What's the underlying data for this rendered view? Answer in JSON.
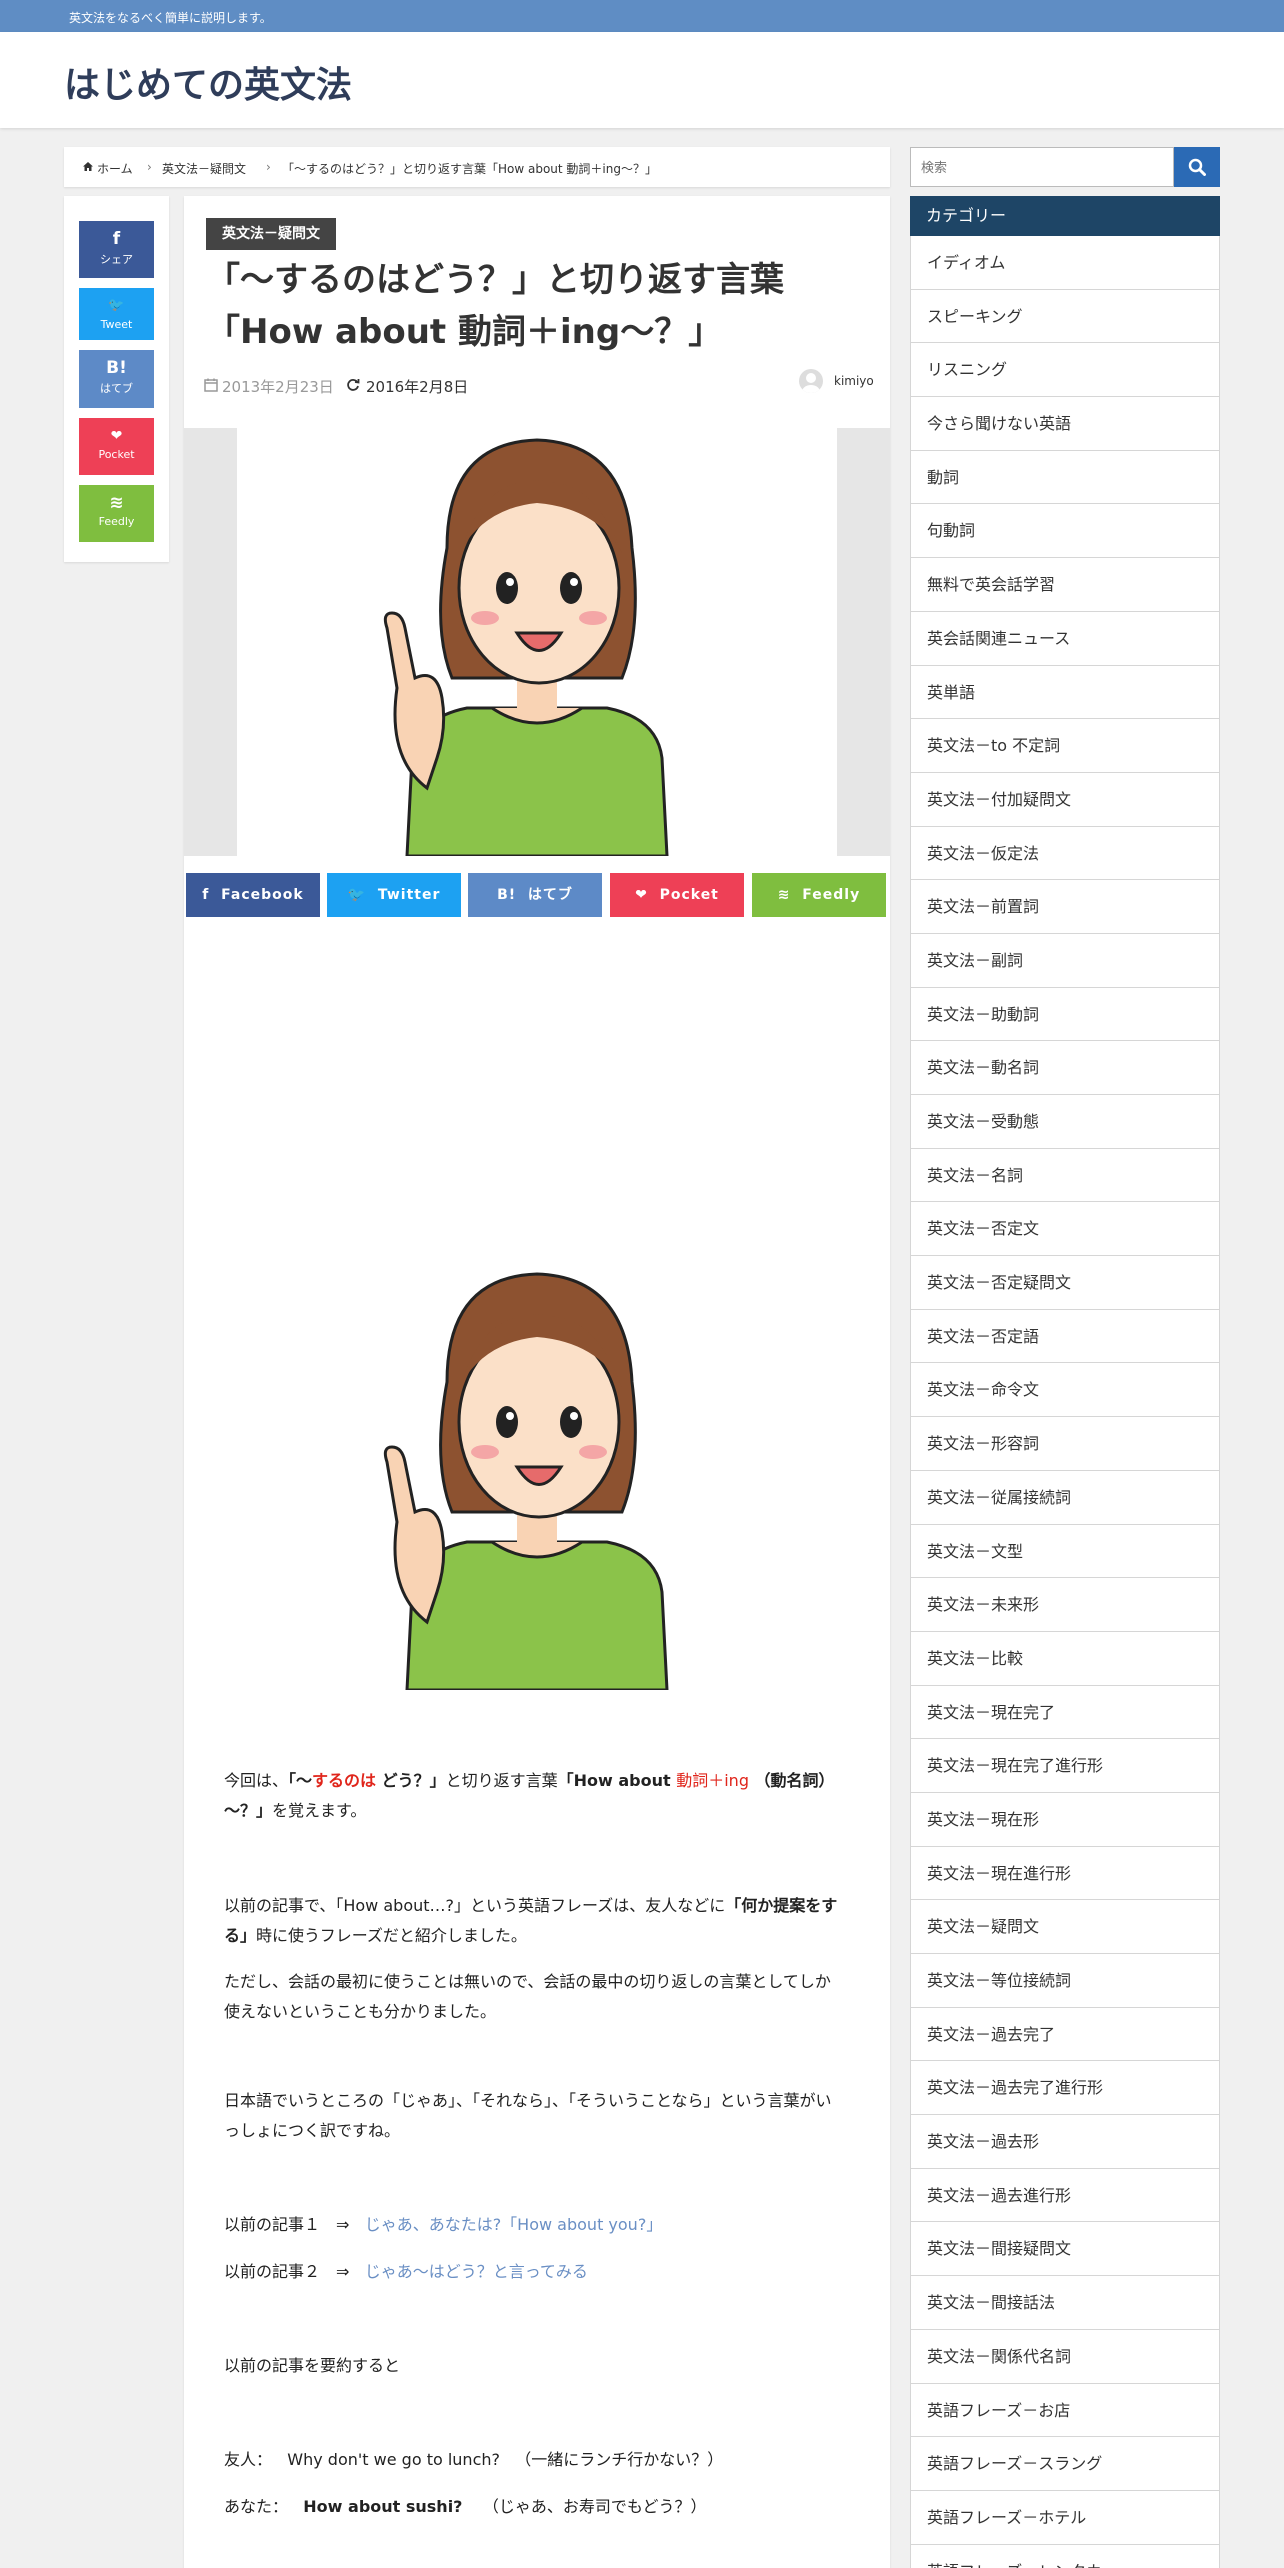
{
  "topbar": {
    "tagline": "英文法をなるべく簡単に説明します。"
  },
  "site": {
    "title": "はじめての英文法"
  },
  "breadcrumb": {
    "home": "ホーム",
    "category": "英文法－疑問文",
    "current": "「～するのはどう？」と切り返す言葉「How about 動詞＋ing～？」",
    "sep": "›"
  },
  "share_vertical": [
    {
      "icon": "f",
      "label": "シェア",
      "color": "#3b5998"
    },
    {
      "icon": "🐦",
      "label": "Tweet",
      "color": "#1da1f2"
    },
    {
      "icon": "B!",
      "label": "はてブ",
      "color": "#5d8ac7"
    },
    {
      "icon": "❤",
      "label": "Pocket",
      "color": "#ee4056"
    },
    {
      "icon": "≋",
      "label": "Feedly",
      "color": "#7fbe3f"
    }
  ],
  "article": {
    "category": "英文法－疑問文",
    "title_line1": "「～するのはどう？」と切り返す言葉",
    "title_line2": "「How about 動詞＋ing～？」",
    "published": "2013年2月23日",
    "updated": "2016年2月8日",
    "author": "kimiyo"
  },
  "share_horizontal": [
    {
      "icon": "f",
      "label": "Facebook",
      "color": "#3b5998"
    },
    {
      "icon": "🐦",
      "label": "Twitter",
      "color": "#1da1f2"
    },
    {
      "icon": "B!",
      "label": "はてブ",
      "color": "#5d8ac7"
    },
    {
      "icon": "❤",
      "label": "Pocket",
      "color": "#ee4056"
    },
    {
      "icon": "≋",
      "label": "Feedly",
      "color": "#7fbe3f"
    }
  ],
  "body": {
    "p1_a": "今回は、",
    "p1_b": "「～",
    "p1_c": "するのは",
    "p1_d": " どう？」",
    "p1_e": "と切り返す言葉",
    "p1_f": "「How about ",
    "p1_g": "動詞＋ing",
    "p1_h": " （動名詞）～？」",
    "p1_i": "を覚えます。",
    "p2_a": "以前の記事で、「How about…?」という英語フレーズは、友人などに",
    "p2_b": "「何か提案をする」",
    "p2_c": "時に使うフレーズだと紹介しました。",
    "p3": "ただし、会話の最初に使うことは無いので、会話の最中の切り返しの言葉としてしか使えないということも分かりました。",
    "p4": "日本語でいうところの「じゃあ」、「それなら」、「そういうことなら」という言葉がいっしょにつく訳ですね。",
    "ref1_label": "以前の記事１　⇒",
    "ref1_link": "じゃあ、あなたは?「How about you?」",
    "ref2_label": "以前の記事２　⇒",
    "ref2_link": "じゃあ～はどう？と言ってみる",
    "p5": "以前の記事を要約すると",
    "d1_speaker": "友人：",
    "d1_en": "Why don't we go to lunch?",
    "d1_ja": "（一緒にランチ行かない？）",
    "d2_speaker": "あなた：",
    "d2_en": "How about sushi?",
    "d2_ja": "（じゃあ、お寿司でもどう？）"
  },
  "sidebar": {
    "search_placeholder": "検索",
    "categories_title": "カテゴリー",
    "categories": [
      "イディオム",
      "スピーキング",
      "リスニング",
      "今さら聞けない英語",
      "動詞",
      "句動詞",
      "無料で英会話学習",
      "英会話関連ニュース",
      "英単語",
      "英文法－to 不定詞",
      "英文法－付加疑問文",
      "英文法－仮定法",
      "英文法－前置詞",
      "英文法－副詞",
      "英文法－助動詞",
      "英文法－動名詞",
      "英文法－受動態",
      "英文法－名詞",
      "英文法－否定文",
      "英文法－否定疑問文",
      "英文法－否定語",
      "英文法－命令文",
      "英文法－形容詞",
      "英文法－従属接続詞",
      "英文法－文型",
      "英文法－未来形",
      "英文法－比較",
      "英文法－現在完了",
      "英文法－現在完了進行形",
      "英文法－現在形",
      "英文法－現在進行形",
      "英文法－疑問文",
      "英文法－等位接続詞",
      "英文法－過去完了",
      "英文法－過去完了進行形",
      "英文法－過去形",
      "英文法－過去進行形",
      "英文法－間接疑問文",
      "英文法－間接話法",
      "英文法－関係代名詞",
      "英語フレーズ－お店",
      "英語フレーズ－スラング",
      "英語フレーズ－ホテル",
      "英語フレーズ－レンタカー"
    ]
  }
}
